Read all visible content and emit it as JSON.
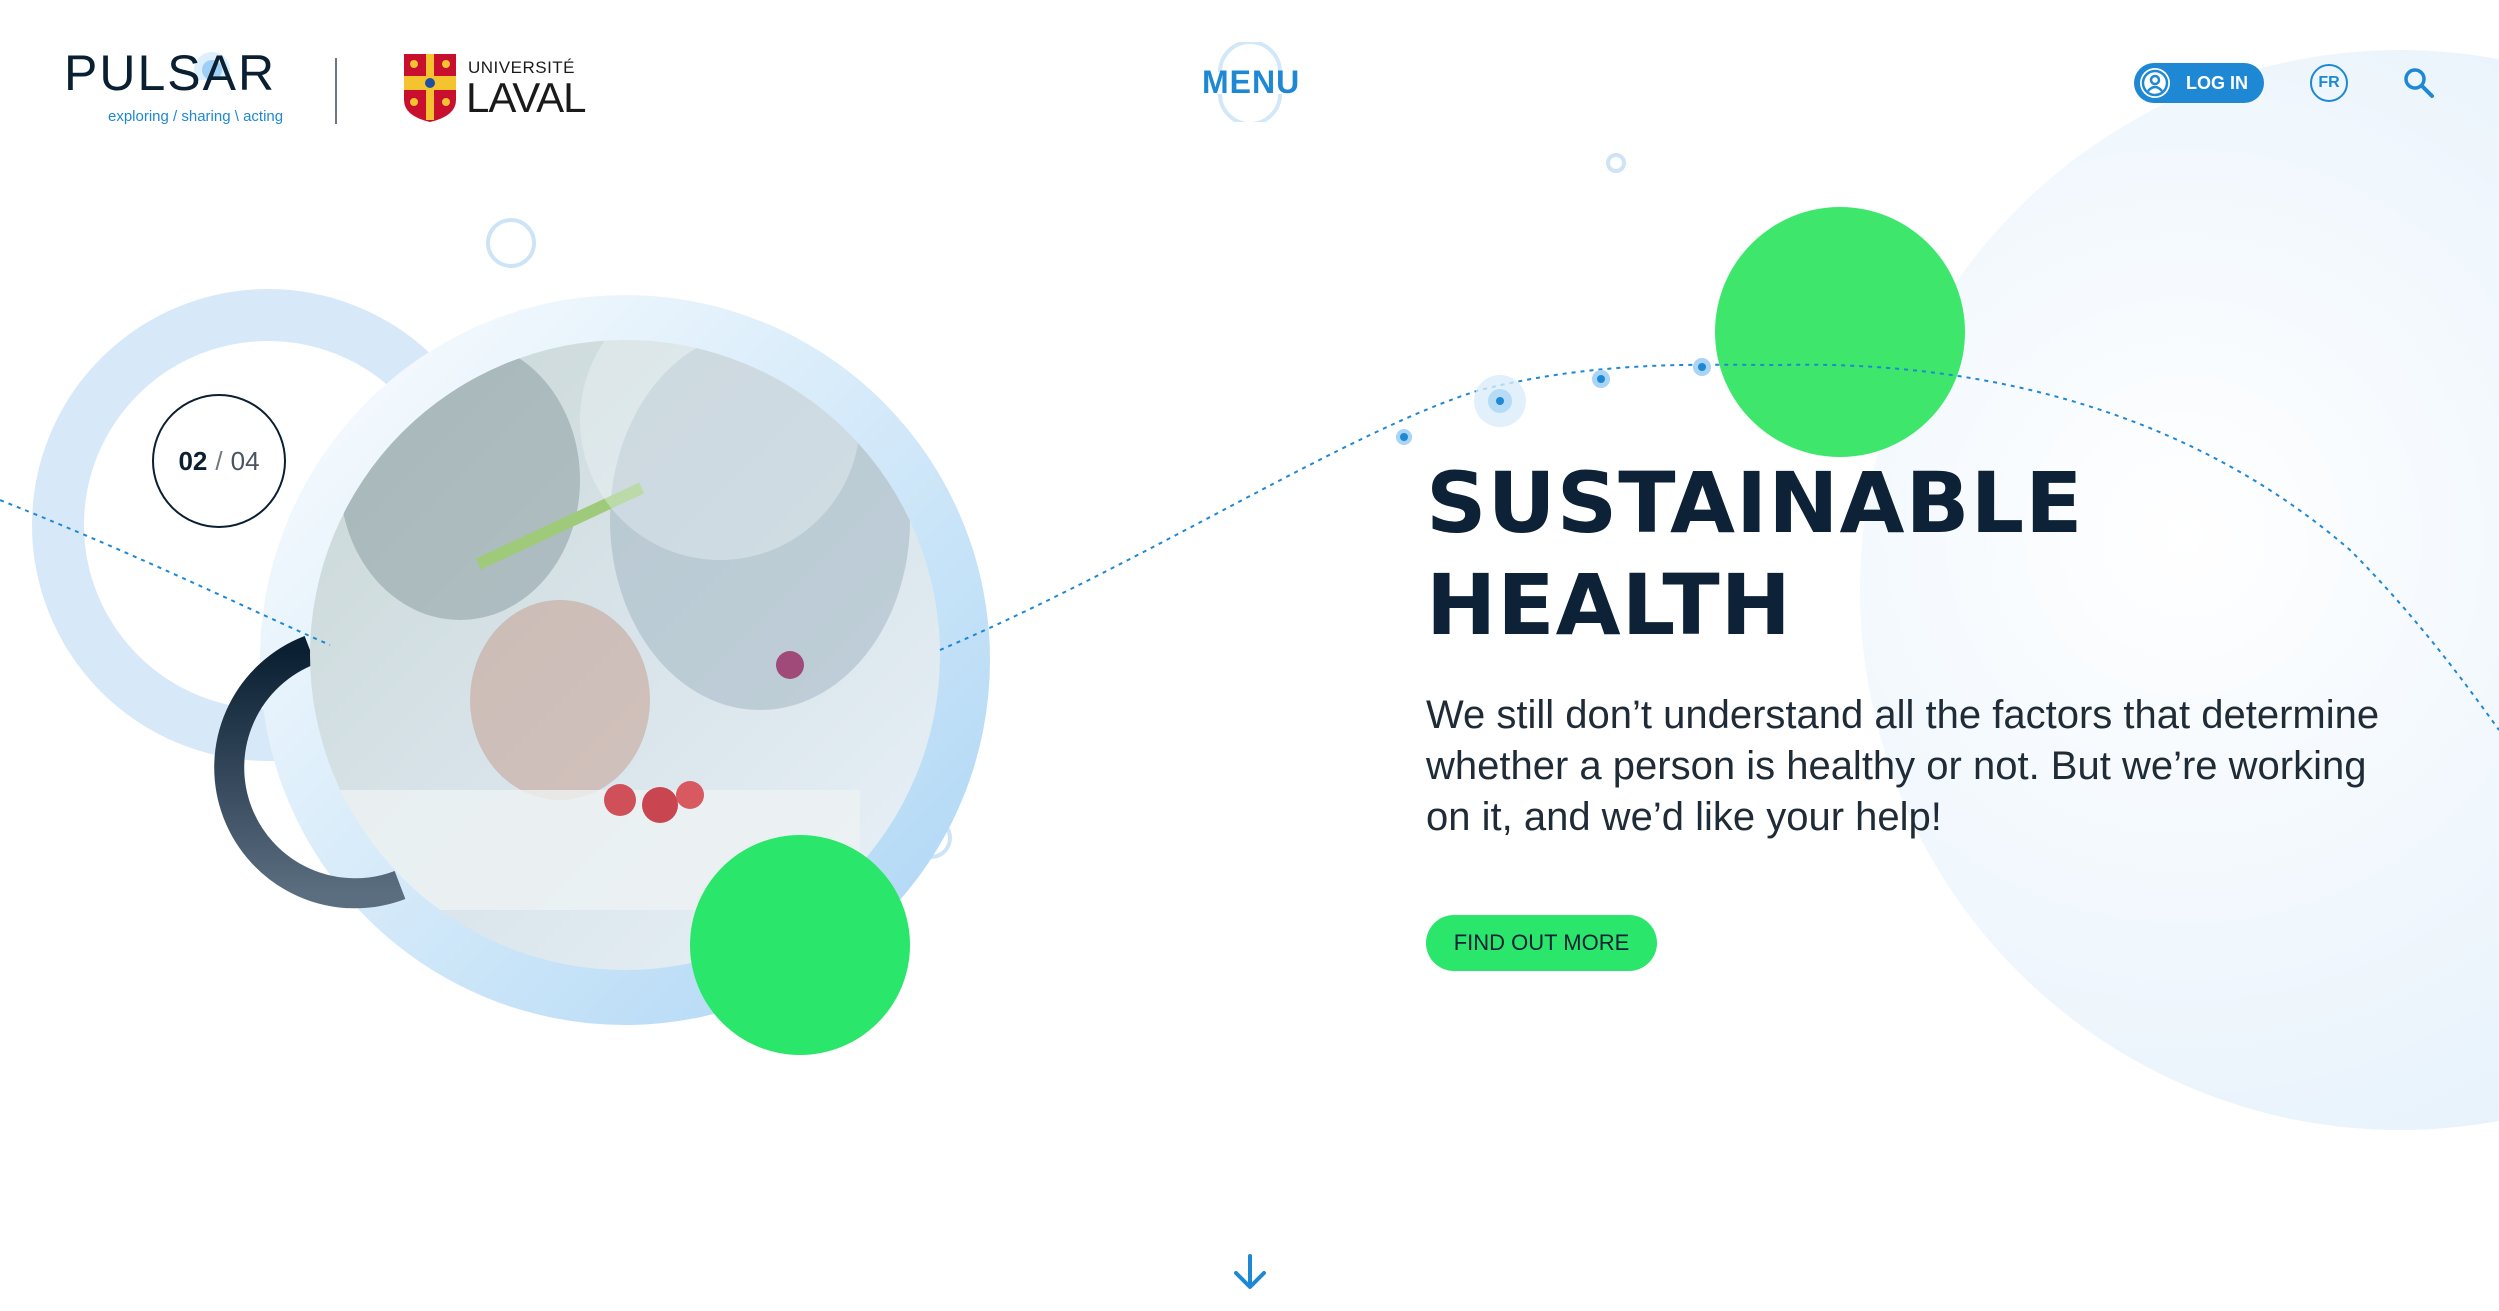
{
  "header": {
    "pulsar_name": "PULSAR",
    "pulsar_tagline": "exploring / sharing \\ acting",
    "university_small": "UNIVERSITÉ",
    "university_big": "LAVAL",
    "menu_label": "MENU",
    "login_label": "LOG IN",
    "lang_label": "FR"
  },
  "slider": {
    "current": "02",
    "separator": "/",
    "total": "04"
  },
  "hero": {
    "title_line1": "SUSTAINABLE",
    "title_line2": "HEALTH",
    "description": "We still don’t understand all the factors that determine whether a person is healthy or not. But we’re working on it, and we’d like your help!",
    "cta_label": "FIND OUT MORE"
  },
  "icons": {
    "user": "user-circle-icon",
    "search": "search-icon",
    "scroll": "arrow-down-icon"
  },
  "colors": {
    "accent_blue": "#1e88d4",
    "accent_green": "#2ae66a",
    "dark_navy": "#0d2236",
    "light_blue": "#d9ecfa"
  }
}
